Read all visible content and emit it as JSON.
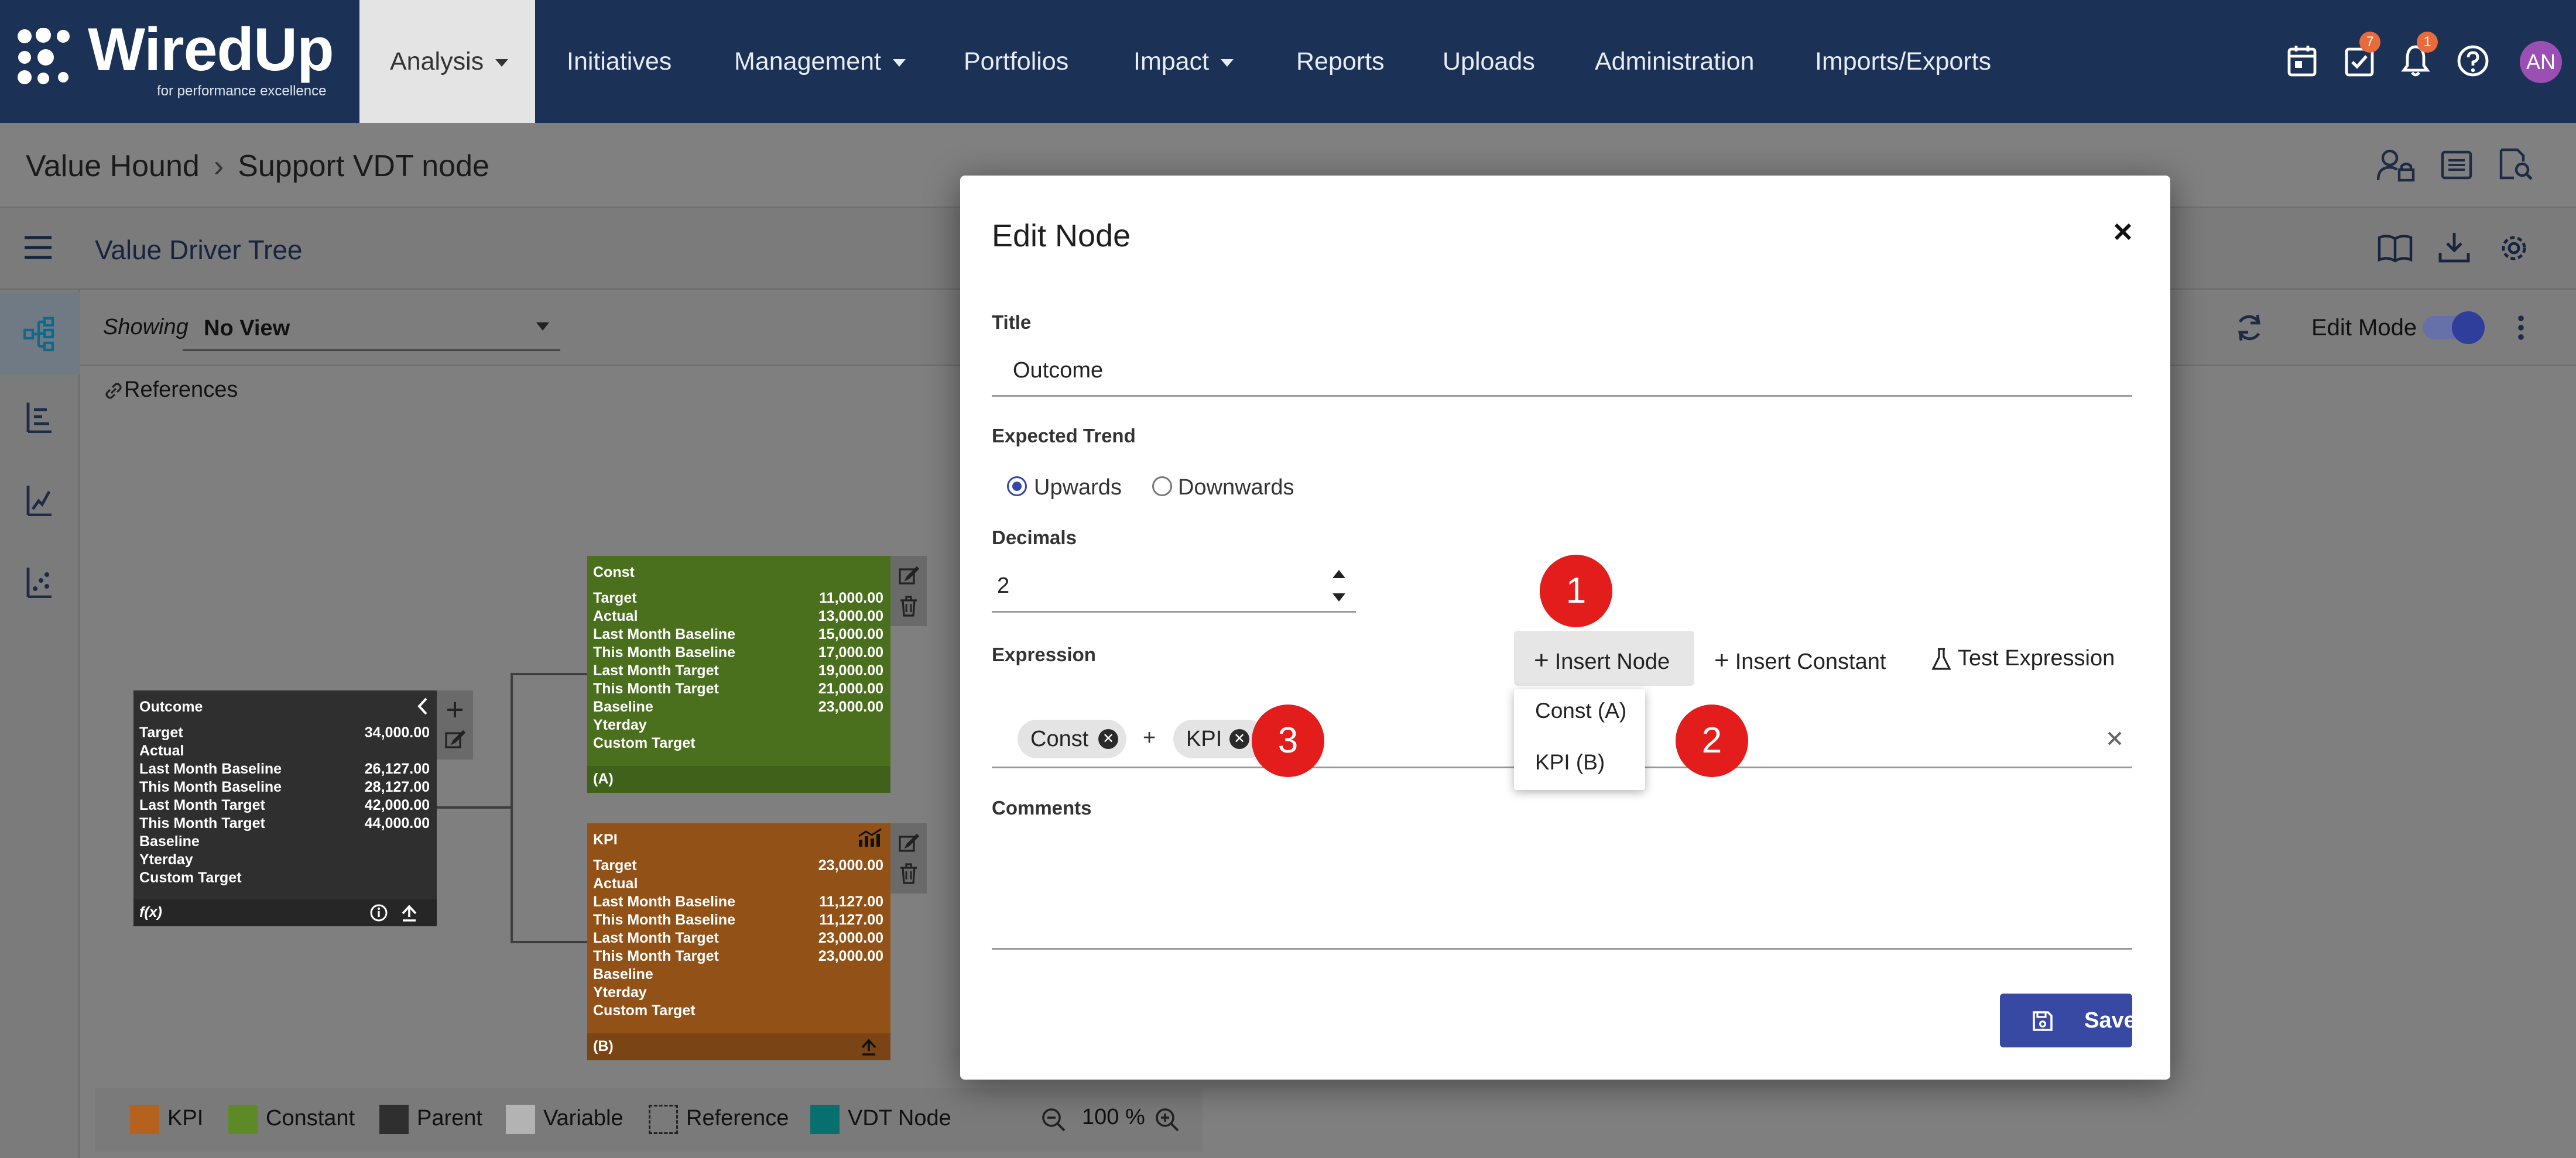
{
  "brand": {
    "name": "WiredUp",
    "tagline": "for performance excellence",
    "colors": {
      "nav_bg": "#1b3156",
      "primary": "#3849a4",
      "marker": "#e31c1c"
    }
  },
  "nav": {
    "items": [
      {
        "label": "Analysis",
        "has_menu": true,
        "active": true
      },
      {
        "label": "Initiatives",
        "has_menu": false
      },
      {
        "label": "Management",
        "has_menu": true
      },
      {
        "label": "Portfolios",
        "has_menu": false
      },
      {
        "label": "Impact",
        "has_menu": true
      },
      {
        "label": "Reports",
        "has_menu": false
      },
      {
        "label": "Uploads",
        "has_menu": false
      },
      {
        "label": "Administration",
        "has_menu": false
      },
      {
        "label": "Imports/Exports",
        "has_menu": false
      }
    ],
    "right_icons": [
      "calendar-icon",
      "tasks-icon",
      "bell-icon",
      "help-icon"
    ],
    "tasks_badge": "7",
    "notifications_badge": "1",
    "avatar_initials": "AN"
  },
  "breadcrumb": {
    "parent": "Value Hound",
    "current": "Support VDT node"
  },
  "tree": {
    "title": "Value Driver Tree",
    "showing_label": "Showing",
    "view_value": "No View",
    "references_label": "References",
    "edit_mode_label": "Edit Mode",
    "edit_mode_on": true
  },
  "nodes": {
    "outcome": {
      "title": "Outcome",
      "rows": [
        {
          "label": "Target",
          "value": "34,000.00"
        },
        {
          "label": "Actual",
          "value": ""
        },
        {
          "label": "Last Month Baseline",
          "value": "26,127.00"
        },
        {
          "label": "This Month Baseline",
          "value": "28,127.00"
        },
        {
          "label": "Last Month Target",
          "value": "42,000.00"
        },
        {
          "label": "This Month Target",
          "value": "44,000.00"
        },
        {
          "label": "Baseline",
          "value": ""
        },
        {
          "label": "Yterday",
          "value": ""
        },
        {
          "label": "Custom Target",
          "value": ""
        }
      ],
      "footer": "f(x)"
    },
    "const": {
      "title": "Const",
      "rows": [
        {
          "label": "Target",
          "value": "11,000.00"
        },
        {
          "label": "Actual",
          "value": "13,000.00"
        },
        {
          "label": "Last Month Baseline",
          "value": "15,000.00"
        },
        {
          "label": "This Month Baseline",
          "value": "17,000.00"
        },
        {
          "label": "Last Month Target",
          "value": "19,000.00"
        },
        {
          "label": "This Month Target",
          "value": "21,000.00"
        },
        {
          "label": "Baseline",
          "value": "23,000.00"
        },
        {
          "label": "Yterday",
          "value": ""
        },
        {
          "label": "Custom Target",
          "value": ""
        }
      ],
      "footer": "(A)"
    },
    "kpi": {
      "title": "KPI",
      "rows": [
        {
          "label": "Target",
          "value": "23,000.00"
        },
        {
          "label": "Actual",
          "value": ""
        },
        {
          "label": "Last Month Baseline",
          "value": "11,127.00"
        },
        {
          "label": "This Month Baseline",
          "value": "11,127.00"
        },
        {
          "label": "Last Month Target",
          "value": "23,000.00"
        },
        {
          "label": "This Month Target",
          "value": "23,000.00"
        },
        {
          "label": "Baseline",
          "value": ""
        },
        {
          "label": "Yterday",
          "value": ""
        },
        {
          "label": "Custom Target",
          "value": ""
        }
      ],
      "footer": "(B)"
    }
  },
  "legend": {
    "items": [
      {
        "label": "KPI",
        "color": "#b4621d"
      },
      {
        "label": "Constant",
        "color": "#5b8a26"
      },
      {
        "label": "Parent",
        "color": "#2f2f2f"
      },
      {
        "label": "Variable",
        "color": "#b3b3b3"
      },
      {
        "label": "Reference",
        "color": "dashed"
      },
      {
        "label": "VDT Node",
        "color": "#07706e"
      }
    ],
    "zoom": "100 %"
  },
  "modal": {
    "title": "Edit Node",
    "title_label": "Title",
    "title_value": "Outcome",
    "trend_label": "Expected Trend",
    "trend_up": "Upwards",
    "trend_down": "Downwards",
    "trend_selected": "Upwards",
    "decimals_label": "Decimals",
    "decimals_value": "2",
    "expression_label": "Expression",
    "insert_node": "Insert Node",
    "insert_constant": "Insert Constant",
    "test_expression": "Test Expression",
    "expression_tokens": [
      {
        "type": "chip",
        "label": "Const"
      },
      {
        "type": "operator",
        "label": "+"
      },
      {
        "type": "chip",
        "label": "KPI"
      }
    ],
    "dropdown_items": [
      "Const (A)",
      "KPI (B)"
    ],
    "comments_label": "Comments",
    "save_label": "Save",
    "markers": [
      "1",
      "2",
      "3"
    ]
  }
}
